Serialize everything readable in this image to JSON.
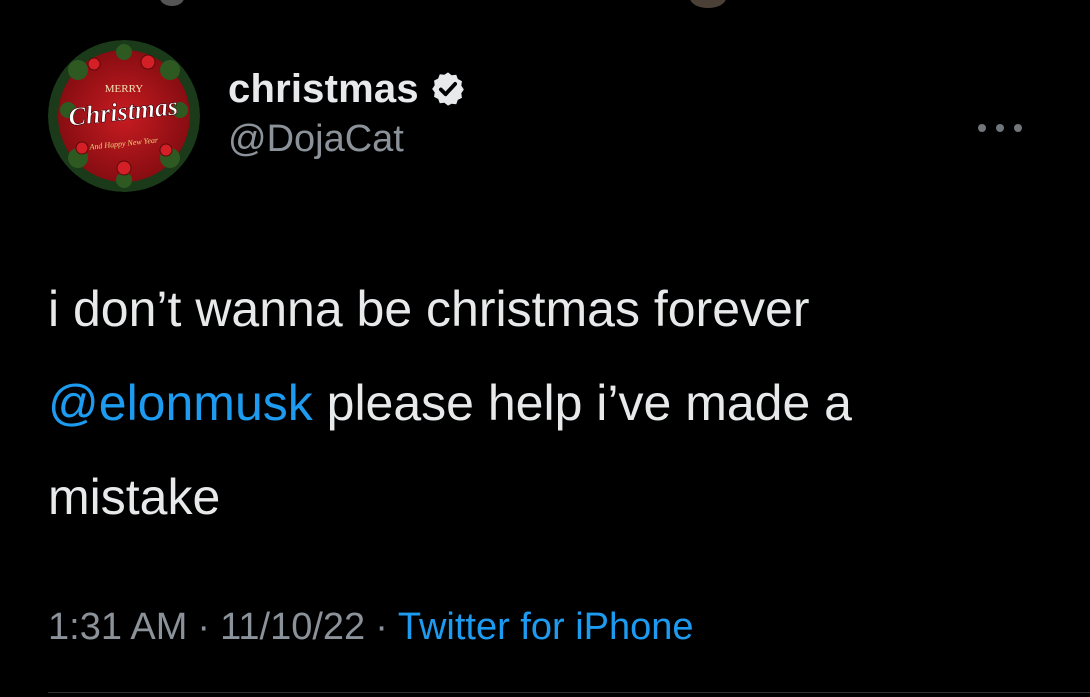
{
  "tweet": {
    "display_name": "christmas",
    "handle": "@DojaCat",
    "verified": true,
    "text_line1": "i don’t wanna be christmas forever",
    "mention": "@elonmusk",
    "text_after_mention": " please help i’ve made a",
    "text_line3": "mistake",
    "time": "1:31 AM",
    "date": "11/10/22",
    "source": "Twitter for iPhone",
    "separator": "·"
  },
  "avatar": {
    "line1": "MERRY",
    "line2": "Christmas",
    "line3": "And Happy New Year"
  },
  "colors": {
    "background": "#000000",
    "text": "#e7e9ea",
    "secondary": "#8b9299",
    "link": "#1d9bf0",
    "avatar_red": "#b3141a"
  },
  "icons": {
    "verified": "verified-badge-icon",
    "more": "more-options-icon"
  }
}
